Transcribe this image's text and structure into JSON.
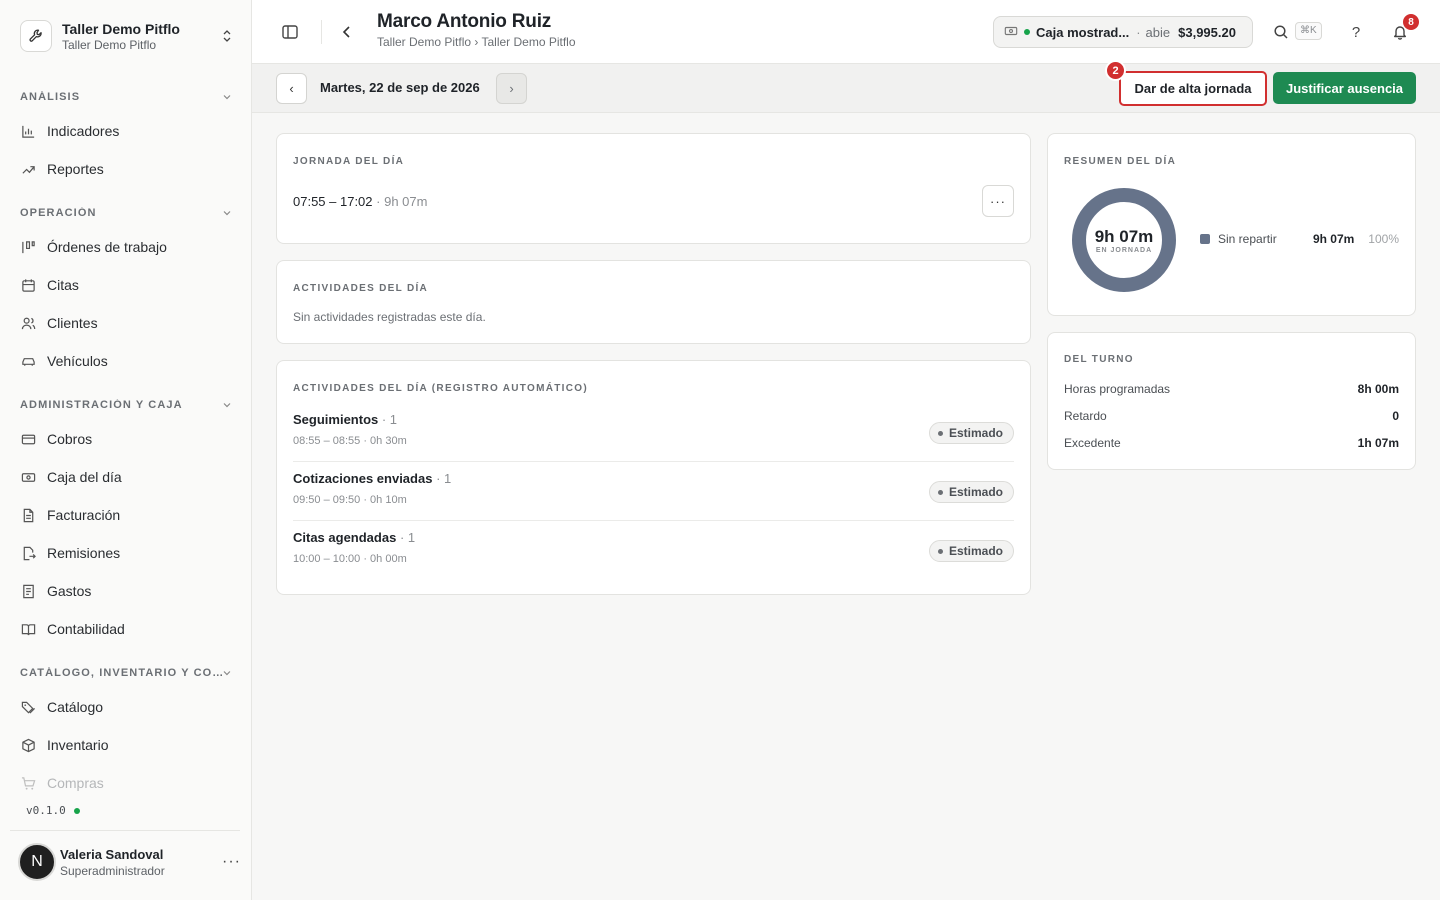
{
  "workspace": {
    "name": "Taller Demo Pitflo",
    "subtitle": "Taller Demo Pitflo"
  },
  "sidebar": {
    "sections": [
      {
        "label": "ANÁLISIS"
      },
      {
        "label": "OPERACIÓN"
      },
      {
        "label": "ADMINISTRACIÓN Y CAJA"
      },
      {
        "label": "CATÁLOGO, INVENTARIO Y CO…"
      }
    ],
    "items": [
      {
        "label": "Indicadores",
        "icon": "bar-chart-icon"
      },
      {
        "label": "Reportes",
        "icon": "trending-up-icon"
      },
      {
        "label": "Órdenes de trabajo",
        "icon": "kanban-icon"
      },
      {
        "label": "Citas",
        "icon": "calendar-icon"
      },
      {
        "label": "Clientes",
        "icon": "users-icon"
      },
      {
        "label": "Vehículos",
        "icon": "car-icon"
      },
      {
        "label": "Cobros",
        "icon": "credit-card-icon"
      },
      {
        "label": "Caja del día",
        "icon": "banknote-icon"
      },
      {
        "label": "Facturación",
        "icon": "file-text-icon"
      },
      {
        "label": "Remisiones",
        "icon": "file-output-icon"
      },
      {
        "label": "Gastos",
        "icon": "receipt-icon"
      },
      {
        "label": "Contabilidad",
        "icon": "book-open-icon"
      },
      {
        "label": "Catálogo",
        "icon": "tags-icon"
      },
      {
        "label": "Inventario",
        "icon": "package-icon"
      },
      {
        "label": "Compras",
        "icon": "shopping-cart-icon"
      }
    ],
    "version": "v0.1.0",
    "user": {
      "initial": "N",
      "name": "Valeria Sandoval",
      "role": "Superadministrador"
    }
  },
  "header": {
    "title": "Marco Antonio Ruiz",
    "breadcrumb": "Taller Demo Pitflo › Taller Demo Pitflo",
    "cash": {
      "name": "Caja mostrad...",
      "separator": "·",
      "status": "abie",
      "amount": "$3,995.20",
      "status_color": "#16a34a"
    },
    "shortcut": "⌘K",
    "help": "?",
    "notifications": "8"
  },
  "datebar": {
    "prev": "‹",
    "next": "›",
    "date": "Martes, 22 de sep de 2026",
    "step_badge": "2",
    "register_label": "Dar de alta jornada",
    "justify_label": "Justificar ausencia"
  },
  "jornada": {
    "heading": "JORNADA DEL DÍA",
    "range": "07:55 – 17:02",
    "separator": " · ",
    "duration": "9h 07m",
    "more": "···"
  },
  "actividades": {
    "heading": "ACTIVIDADES DEL DÍA",
    "empty": "Sin actividades registradas este día."
  },
  "auto": {
    "heading": "ACTIVIDADES DEL DÍA (REGISTRO AUTOMÁTICO)",
    "rows": [
      {
        "title": "Seguimientos",
        "count": " · 1",
        "time": "08:55 – 08:55 · 0h 30m",
        "badge": "Estimado"
      },
      {
        "title": "Cotizaciones enviadas",
        "count": " · 1",
        "time": "09:50 – 09:50 · 0h 10m",
        "badge": "Estimado"
      },
      {
        "title": "Citas agendadas",
        "count": " · 1",
        "time": "10:00 – 10:00 · 0h 00m",
        "badge": "Estimado"
      }
    ]
  },
  "resumen": {
    "heading": "RESUMEN DEL DÍA",
    "center_value": "9h 07m",
    "center_label": "EN JORNADA",
    "legend": {
      "name": "Sin repartir",
      "value": "9h 07m",
      "percent": "100%",
      "color": "#66738a"
    }
  },
  "turno": {
    "heading": "DEL TURNO",
    "rows": [
      {
        "label": "Horas programadas",
        "value": "8h 00m"
      },
      {
        "label": "Retardo",
        "value": "0"
      },
      {
        "label": "Excedente",
        "value": "1h 07m"
      }
    ]
  },
  "colors": {
    "accent_green": "#1e8a52",
    "highlight_red": "#d12f2f"
  }
}
